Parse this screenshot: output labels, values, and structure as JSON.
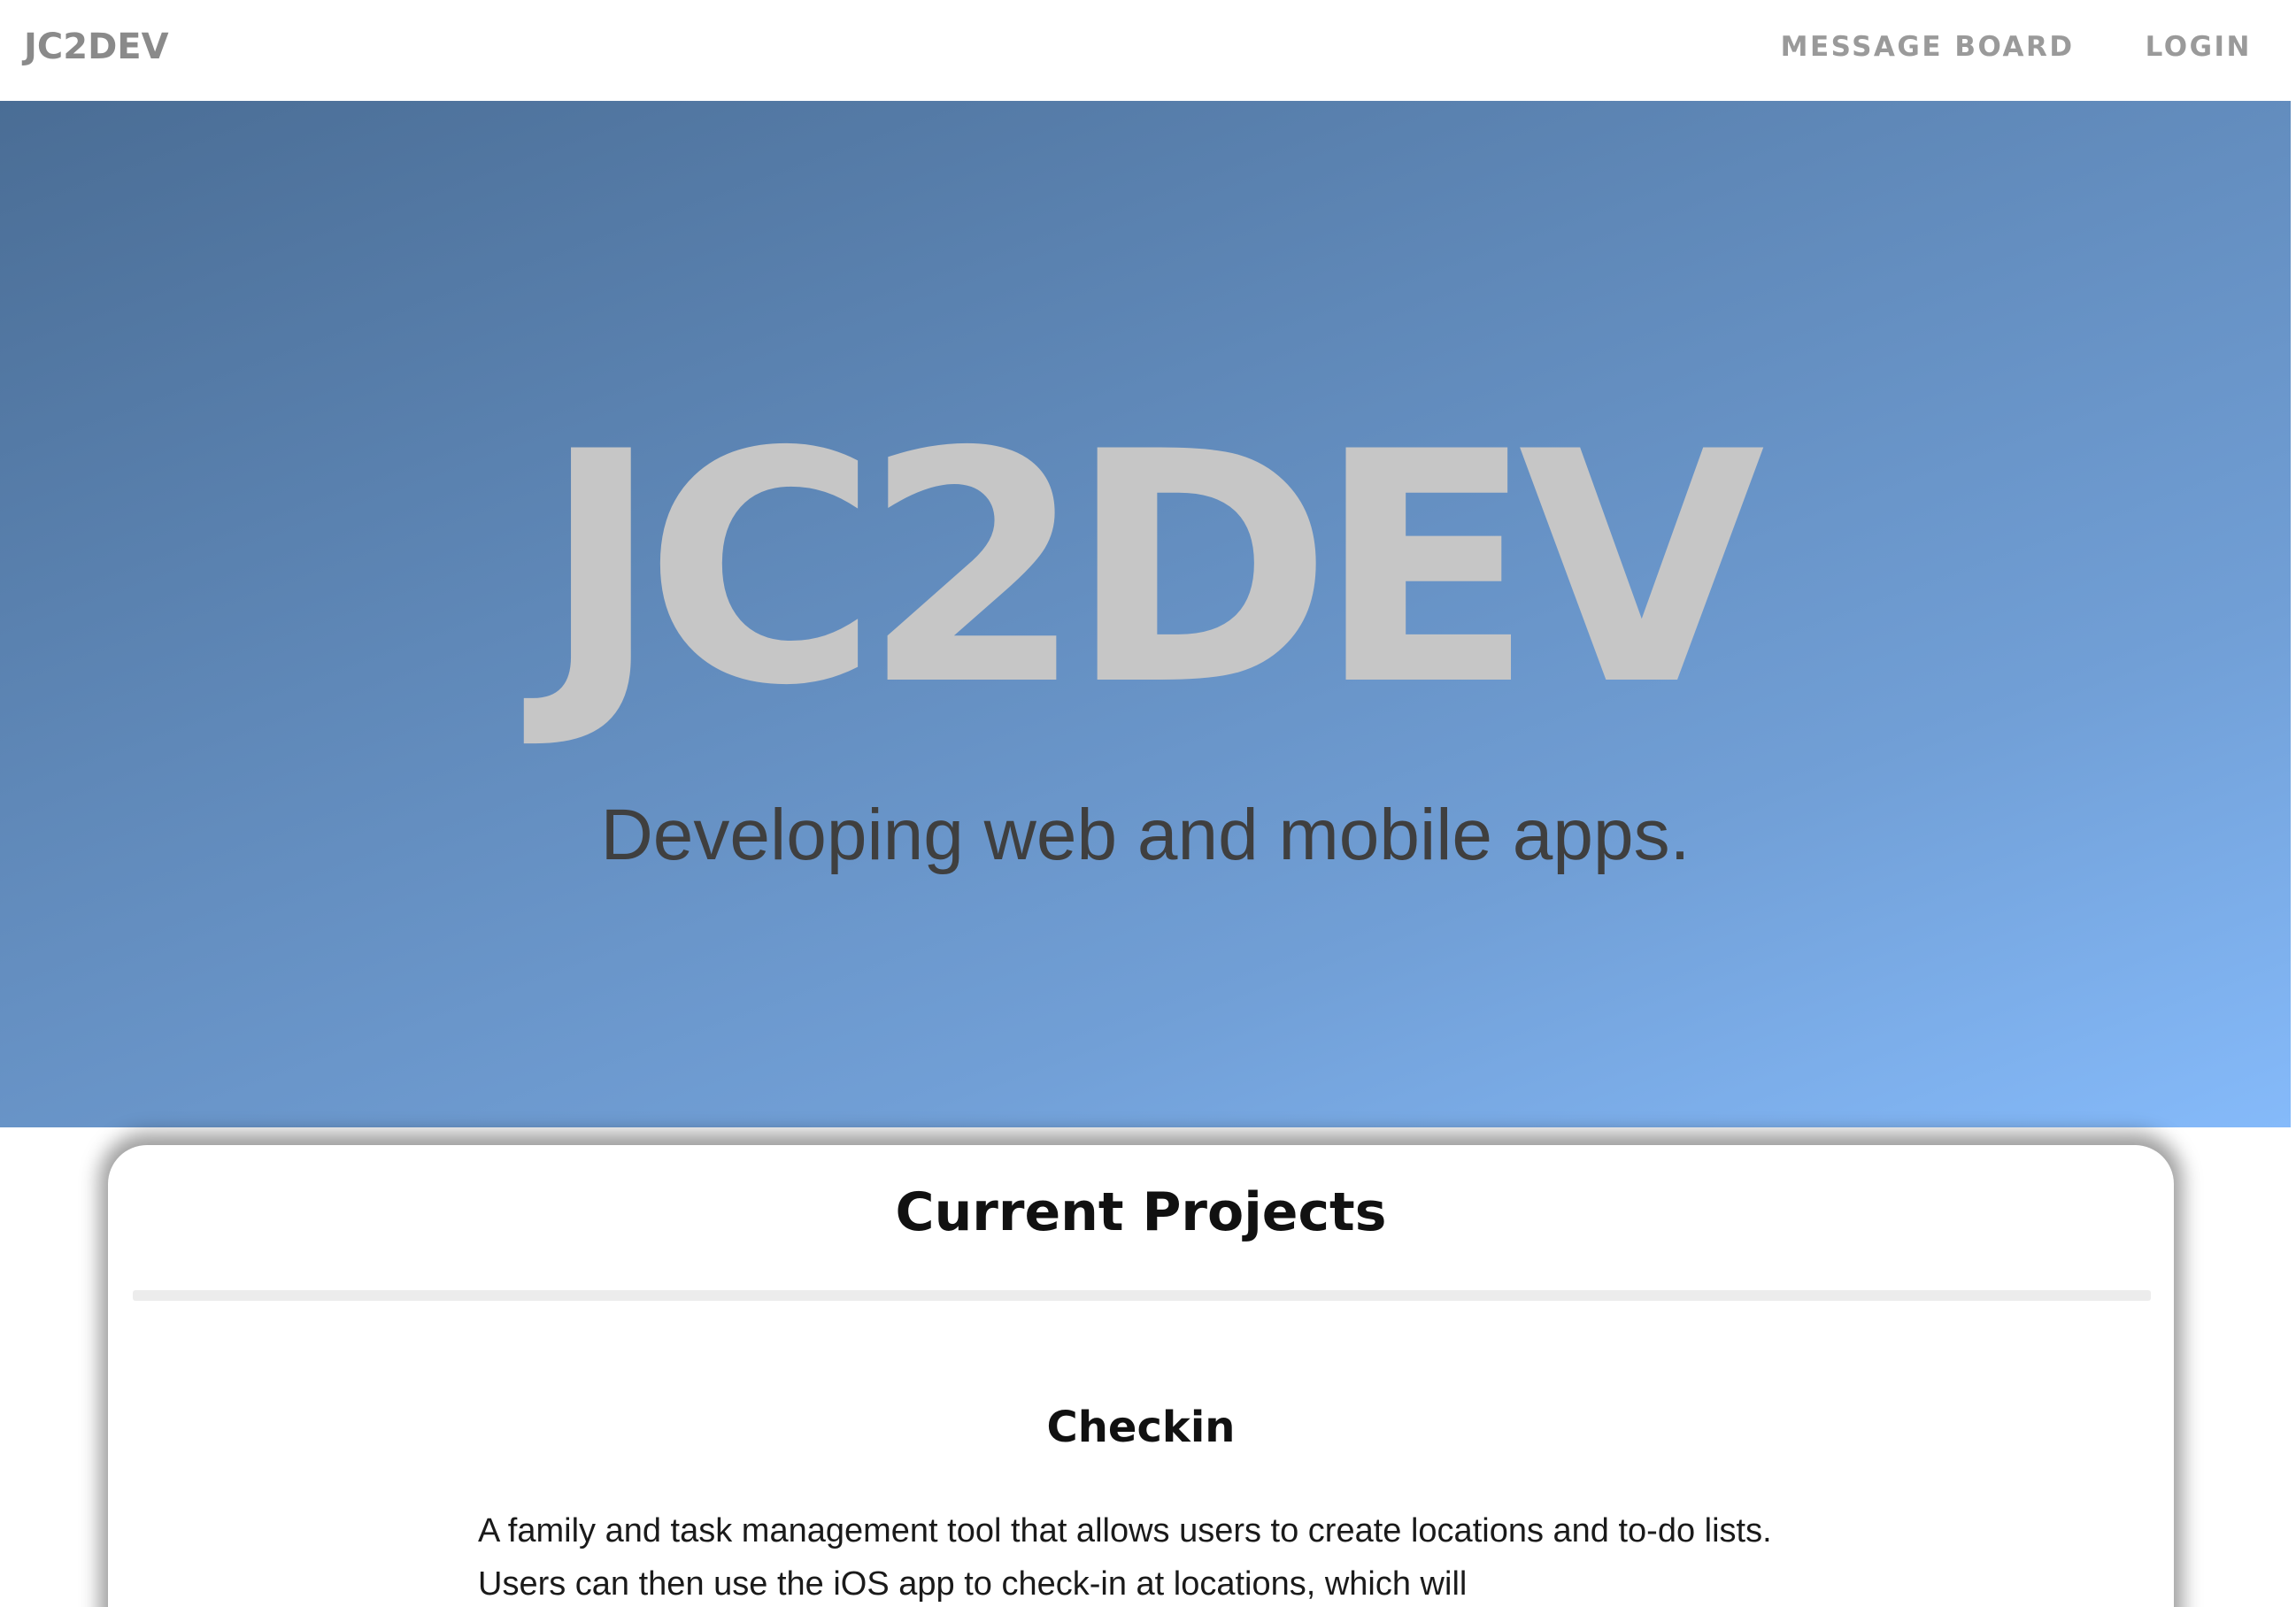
{
  "navbar": {
    "brand": "JC2DEV",
    "links": [
      {
        "label": "MESSAGE BOARD"
      },
      {
        "label": "LOGIN"
      }
    ]
  },
  "hero": {
    "title": "JC2DEV",
    "subtitle": "Developing web and mobile apps."
  },
  "projects": {
    "heading": "Current Projects",
    "items": [
      {
        "title": "Checkin",
        "description": "A family and task management tool that allows users to create locations and to-do lists. Users can then use the iOS app to check-in at locations, which will"
      }
    ]
  },
  "colors": {
    "hero_gradient_start": "#4a6d95",
    "hero_gradient_end": "#85bafa",
    "hero_title": "#c6c6c6",
    "nav_text": "#9a9a9a"
  }
}
